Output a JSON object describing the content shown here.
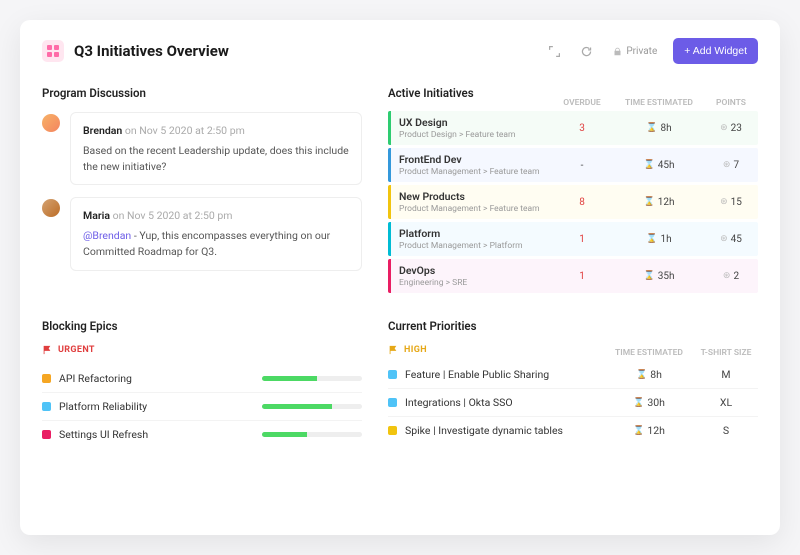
{
  "header": {
    "title": "Q3 Initiatives Overview",
    "privacy": "Private",
    "add_widget": "+ Add Widget"
  },
  "discussion": {
    "title": "Program Discussion",
    "comments": [
      {
        "author": "Brendan",
        "time": "on Nov 5 2020 at 2:50 pm",
        "body": "Based on the recent Leadership update, does this include the new initiative?"
      },
      {
        "author": "Maria",
        "time": "on Nov 5 2020 at 2:50 pm",
        "mention": "@Brendan",
        "body": " - Yup, this encompasses everything on our Committed Roadmap for Q3."
      }
    ]
  },
  "initiatives": {
    "title": "Active Initiatives",
    "cols": {
      "overdue": "OVERDUE",
      "time": "TIME ESTIMATED",
      "points": "POINTS"
    },
    "rows": [
      {
        "name": "UX Design",
        "path": "Product Design > Feature team",
        "overdue": "3",
        "time": "8h",
        "points": "23"
      },
      {
        "name": "FrontEnd Dev",
        "path": "Product Management > Feature team",
        "overdue": "-",
        "time": "45h",
        "points": "7"
      },
      {
        "name": "New Products",
        "path": "Product Management > Feature team",
        "overdue": "8",
        "time": "12h",
        "points": "15"
      },
      {
        "name": "Platform",
        "path": "Product Management > Platform",
        "overdue": "1",
        "time": "1h",
        "points": "45"
      },
      {
        "name": "DevOps",
        "path": "Engineering > SRE",
        "overdue": "1",
        "time": "35h",
        "points": "2"
      }
    ]
  },
  "epics": {
    "title": "Blocking Epics",
    "flag": "URGENT",
    "rows": [
      {
        "name": "API Refactoring",
        "progress": 55
      },
      {
        "name": "Platform Reliability",
        "progress": 70
      },
      {
        "name": "Settings UI Refresh",
        "progress": 45
      }
    ]
  },
  "priorities": {
    "title": "Current Priorities",
    "flag": "HIGH",
    "cols": {
      "time": "TIME ESTIMATED",
      "size": "T-SHIRT SIZE"
    },
    "rows": [
      {
        "name": "Feature | Enable Public Sharing",
        "time": "8h",
        "size": "M"
      },
      {
        "name": "Integrations | Okta SSO",
        "time": "30h",
        "size": "XL"
      },
      {
        "name": "Spike | Investigate dynamic tables",
        "time": "12h",
        "size": "S"
      }
    ]
  }
}
